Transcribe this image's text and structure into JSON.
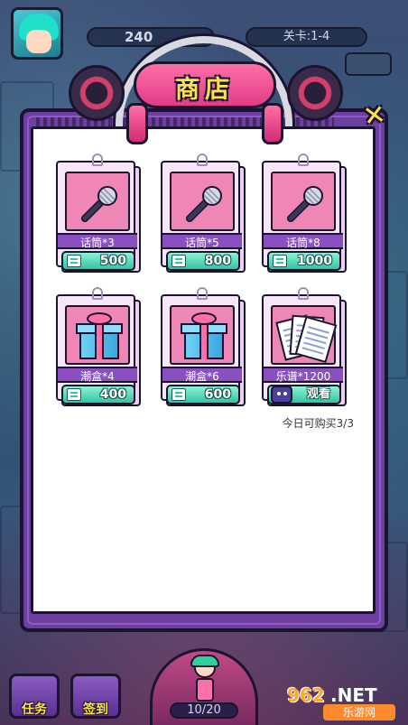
{
  "hud": {
    "coins": "240",
    "level": "关卡:1-4"
  },
  "shop": {
    "title": "商店",
    "close_icon": "close-x-icon",
    "items": [
      {
        "name": "话筒*3",
        "price": "500",
        "icon": "microphone-icon"
      },
      {
        "name": "话筒*5",
        "price": "800",
        "icon": "microphone-icon"
      },
      {
        "name": "话筒*8",
        "price": "1000",
        "icon": "microphone-icon"
      },
      {
        "name": "潮盒*4",
        "price": "400",
        "icon": "gift-box-icon"
      },
      {
        "name": "潮盒*6",
        "price": "600",
        "icon": "gift-box-icon"
      },
      {
        "name": "乐谱*1200",
        "action": "观看",
        "icon": "sheet-music-icon"
      }
    ],
    "daily_limit": "今日可购买3/3"
  },
  "dock": {
    "task_label": "任务",
    "sign_label": "签到",
    "progress": "10/20"
  },
  "watermark": {
    "number": "962",
    "domain": ".NET",
    "tagline": "乐游网"
  },
  "colors": {
    "panel_purple": "#6d3fa0",
    "title_pink": "#e33c86",
    "title_text_yellow": "#ffe14d",
    "button_teal": "#33c4a1",
    "name_bar_purple": "#8a4fc0"
  }
}
